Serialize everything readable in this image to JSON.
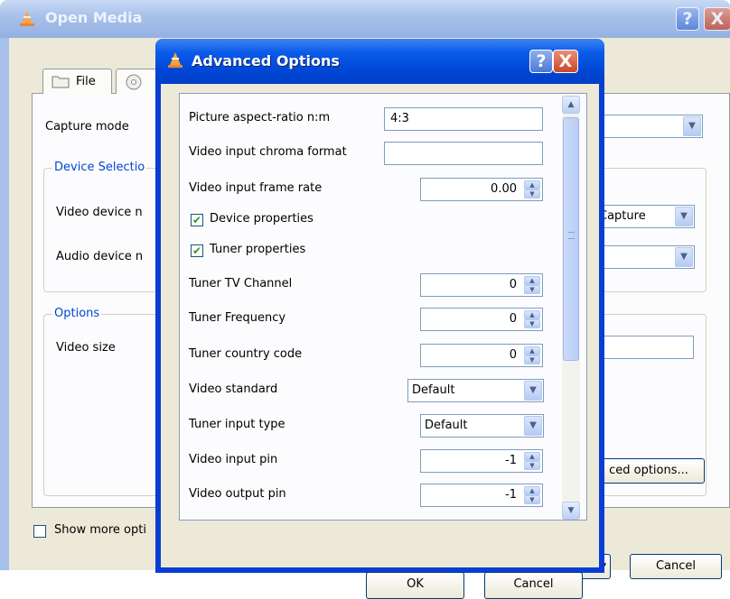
{
  "open_media": {
    "title": "Open Media",
    "tab_file_label": "File",
    "capture_mode_label": "Capture mode",
    "device_selection_label": "Device Selectio",
    "video_device_label": "Video device n",
    "video_device_value": "Capture",
    "audio_device_label": "Audio device n",
    "options_label": "Options",
    "video_size_label": "Video size",
    "advanced_options_button": "ced options...",
    "show_more_options_label": "Show more opti",
    "cancel_button": "Cancel",
    "help_glyph": "?",
    "close_glyph": "X"
  },
  "advanced_options": {
    "title": "Advanced Options",
    "help_glyph": "?",
    "close_glyph": "X",
    "rows": {
      "aspect_ratio": {
        "label": "Picture aspect-ratio n:m",
        "value": "4:3"
      },
      "chroma_format": {
        "label": "Video input chroma format",
        "value": ""
      },
      "frame_rate": {
        "label": "Video input frame rate",
        "value": "0.00"
      },
      "device_properties": {
        "label": "Device properties",
        "checked": true
      },
      "tuner_properties": {
        "label": "Tuner properties",
        "checked": true
      },
      "tv_channel": {
        "label": "Tuner TV Channel",
        "value": "0"
      },
      "frequency": {
        "label": "Tuner Frequency",
        "value": "0"
      },
      "country_code": {
        "label": "Tuner country code",
        "value": "0"
      },
      "video_standard": {
        "label": "Video standard",
        "value": "Default"
      },
      "tuner_input_type": {
        "label": "Tuner input type",
        "value": "Default"
      },
      "video_input_pin": {
        "label": "Video input pin",
        "value": "-1"
      },
      "video_output_pin": {
        "label": "Video output pin",
        "value": "-1"
      }
    },
    "ok_button": "OK",
    "cancel_button": "Cancel"
  },
  "icons": {
    "app": "vlc-cone-icon",
    "folder": "folder-icon",
    "disc": "disc-icon",
    "check": "checkmark-icon",
    "spin_up": "spin-up-icon",
    "spin_down": "spin-down-icon",
    "dropdown": "chevron-down-icon",
    "scroll_up": "scroll-up-icon",
    "scroll_down": "scroll-down-icon"
  },
  "colors": {
    "titlebar_active": "#0047d6",
    "titlebar_inactive": "#a7c0ea",
    "dialog_face": "#ece9d8",
    "group_label": "#0046d5",
    "check_green": "#21a121"
  }
}
